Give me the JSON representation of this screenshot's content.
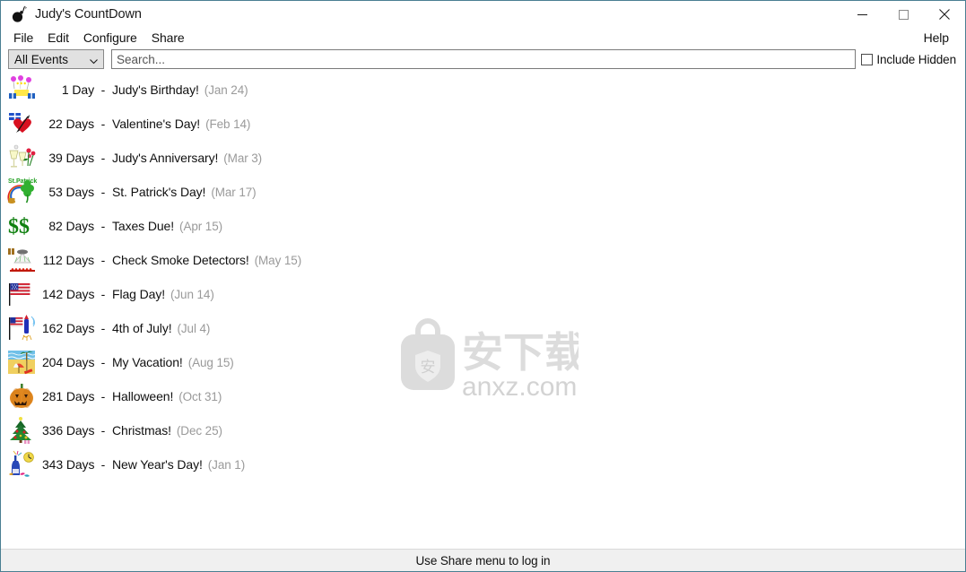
{
  "window": {
    "title": "Judy's CountDown",
    "app_icon": "bomb-icon",
    "border_color": "#4a7f92",
    "controls": [
      {
        "name": "minimize",
        "glyph": "minimize-icon"
      },
      {
        "name": "maximize",
        "glyph": "maximize-icon"
      },
      {
        "name": "close",
        "glyph": "close-icon"
      }
    ]
  },
  "menubar": {
    "left_items": [
      {
        "label": "File"
      },
      {
        "label": "Edit"
      },
      {
        "label": "Configure"
      },
      {
        "label": "Share"
      }
    ],
    "right_items": [
      {
        "label": "Help"
      }
    ]
  },
  "toolbar": {
    "filter": {
      "selected": "All Events",
      "options": [
        "All Events"
      ]
    },
    "search": {
      "value": "",
      "placeholder": "Search..."
    },
    "include_hidden": {
      "label": "Include Hidden",
      "checked": false
    }
  },
  "events": [
    {
      "days": "1 Day",
      "dash": "-",
      "name": "Judy's Birthday!",
      "date": "(Jan 24)",
      "icon": "birthday-cake-icon"
    },
    {
      "days": "22 Days",
      "dash": "-",
      "name": "Valentine's Day!",
      "date": "(Feb 14)",
      "icon": "heart-gift-icon"
    },
    {
      "days": "39 Days",
      "dash": "-",
      "name": "Judy's Anniversary!",
      "date": "(Mar 3)",
      "icon": "champagne-roses-icon"
    },
    {
      "days": "53 Days",
      "dash": "-",
      "name": "St. Patrick's Day!",
      "date": "(Mar 17)",
      "icon": "shamrock-rainbow-icon"
    },
    {
      "days": "82 Days",
      "dash": "-",
      "name": "Taxes Due!",
      "date": "(Apr 15)",
      "icon": "dollar-signs-icon"
    },
    {
      "days": "112 Days",
      "dash": "-",
      "name": "Check Smoke Detectors!",
      "date": "(May 15)",
      "icon": "smoke-detector-icon"
    },
    {
      "days": "142 Days",
      "dash": "-",
      "name": "Flag Day!",
      "date": "(Jun 14)",
      "icon": "us-flag-icon"
    },
    {
      "days": "162 Days",
      "dash": "-",
      "name": "4th of July!",
      "date": "(Jul 4)",
      "icon": "flag-fireworks-icon"
    },
    {
      "days": "204 Days",
      "dash": "-",
      "name": "My Vacation!",
      "date": "(Aug 15)",
      "icon": "beach-icon"
    },
    {
      "days": "281 Days",
      "dash": "-",
      "name": "Halloween!",
      "date": "(Oct 31)",
      "icon": "pumpkin-icon"
    },
    {
      "days": "336 Days",
      "dash": "-",
      "name": "Christmas!",
      "date": "(Dec 25)",
      "icon": "christmas-tree-icon"
    },
    {
      "days": "343 Days",
      "dash": "-",
      "name": "New Year's Day!",
      "date": "(Jan 1)",
      "icon": "new-year-bottle-icon"
    }
  ],
  "watermark": {
    "cjk_text": "安下载",
    "domain_text": "anxz.com",
    "badge_glyph": "安",
    "color": "#dcdcdc"
  },
  "statusbar": {
    "text": "Use Share menu to log in"
  }
}
